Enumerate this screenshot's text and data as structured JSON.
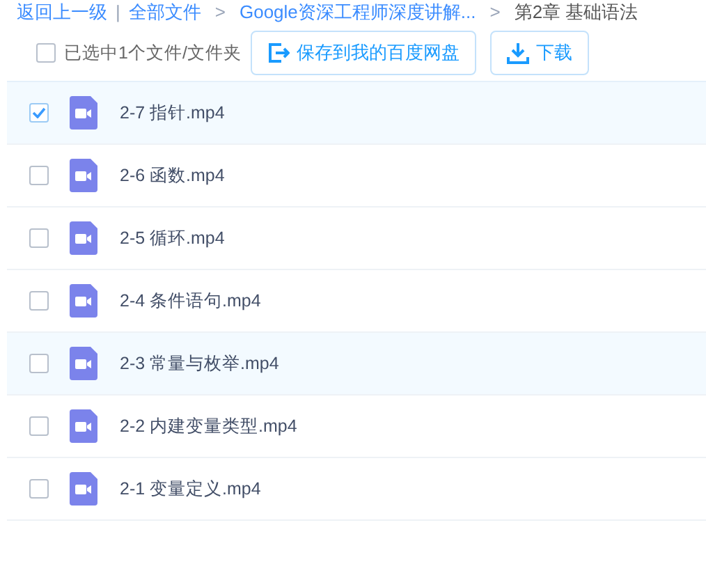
{
  "breadcrumb": {
    "back": "返回上一级",
    "separator": "|",
    "items": [
      {
        "label": "全部文件",
        "current": false
      },
      {
        "label": "Google资深工程师深度讲解...",
        "current": false
      },
      {
        "label": "第2章 基础语法",
        "current": true
      }
    ],
    "arrow": ">"
  },
  "toolbar": {
    "select_all": {
      "label": "已选中1个文件/文件夹",
      "checked": false
    },
    "buttons": [
      {
        "kind": "save",
        "label": "保存到我的百度网盘"
      },
      {
        "kind": "download",
        "label": "下载"
      }
    ]
  },
  "files": [
    {
      "name": "2-7 指针.mp4",
      "checked": true,
      "highlighted": true
    },
    {
      "name": "2-6 函数.mp4",
      "checked": false,
      "highlighted": false
    },
    {
      "name": "2-5 循环.mp4",
      "checked": false,
      "highlighted": false
    },
    {
      "name": "2-4 条件语句.mp4",
      "checked": false,
      "highlighted": false
    },
    {
      "name": "2-3 常量与枚举.mp4",
      "checked": false,
      "highlighted": true
    },
    {
      "name": "2-2 内建变量类型.mp4",
      "checked": false,
      "highlighted": false
    },
    {
      "name": "2-1 变量定义.mp4",
      "checked": false,
      "highlighted": false
    }
  ]
}
